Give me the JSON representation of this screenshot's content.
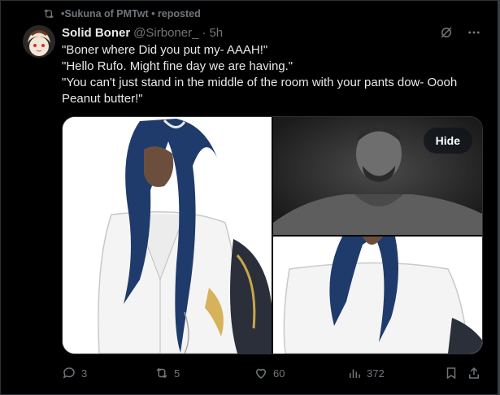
{
  "repost": {
    "text": "Sukuna of PMTwt • reposted",
    "prefix": "• "
  },
  "tweet": {
    "display_name": "Solid Boner",
    "handle": "@Sirboner_",
    "separator": "·",
    "time": "5h",
    "lines": [
      "\"Boner where Did you put my- AAAH!\"",
      "\"Hello Rufo. Might fine day we are having.\"",
      "\"You can't just stand in the middle of the room with your pants dow- Oooh Peanut butter!\""
    ]
  },
  "media": {
    "hide_label": "Hide"
  },
  "actions": {
    "replies": "3",
    "reposts": "5",
    "likes": "60",
    "views": "372"
  },
  "icons": {
    "repost": "repost-icon",
    "grok": "grok-icon",
    "more": "more-icon",
    "reply": "reply-icon",
    "like": "heart-icon",
    "views": "views-icon",
    "bookmark": "bookmark-icon",
    "share": "share-icon"
  },
  "colors": {
    "background": "#000000",
    "text": "#e7e9ea",
    "secondary": "#71767b",
    "border": "#2f3336"
  }
}
